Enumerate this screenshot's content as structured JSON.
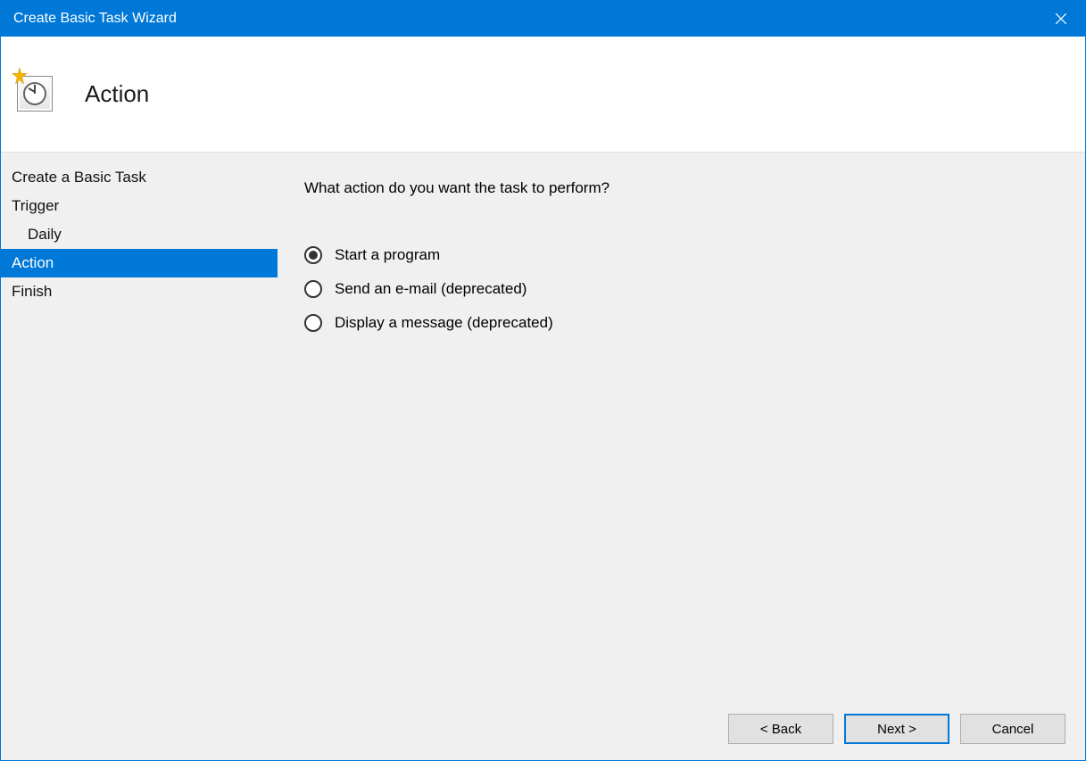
{
  "titlebar": {
    "title": "Create Basic Task Wizard"
  },
  "header": {
    "title": "Action"
  },
  "sidebar": {
    "items": [
      {
        "label": "Create a Basic Task",
        "indent": false,
        "selected": false
      },
      {
        "label": "Trigger",
        "indent": false,
        "selected": false
      },
      {
        "label": "Daily",
        "indent": true,
        "selected": false
      },
      {
        "label": "Action",
        "indent": false,
        "selected": true
      },
      {
        "label": "Finish",
        "indent": false,
        "selected": false
      }
    ]
  },
  "main": {
    "question": "What action do you want the task to perform?",
    "options": [
      {
        "label": "Start a program",
        "checked": true
      },
      {
        "label": "Send an e-mail (deprecated)",
        "checked": false
      },
      {
        "label": "Display a message (deprecated)",
        "checked": false
      }
    ]
  },
  "footer": {
    "back": "< Back",
    "next": "Next >",
    "cancel": "Cancel"
  }
}
